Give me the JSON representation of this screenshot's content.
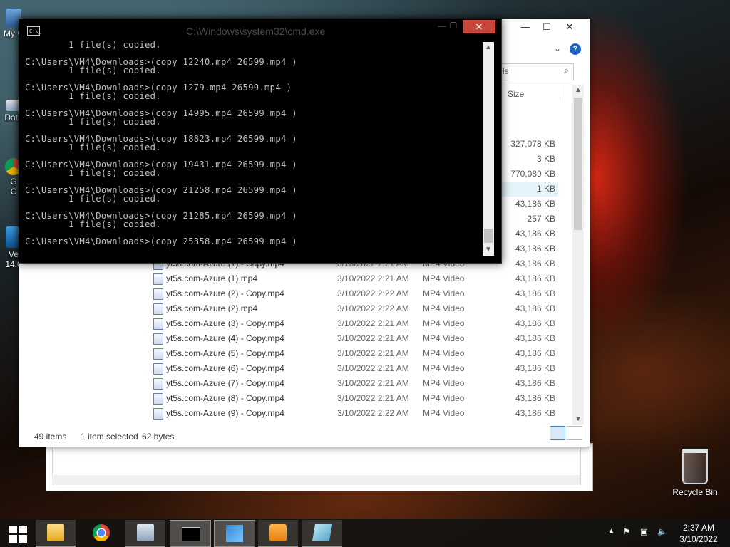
{
  "desktop": {
    "icons": [
      {
        "label": "My C",
        "name": "my-computer"
      },
      {
        "label": "Data",
        "name": "data"
      },
      {
        "label": "G\nC",
        "name": "google-chrome"
      },
      {
        "label": "Ve\n14.0",
        "name": "ve-14"
      }
    ],
    "recycle_bin": "Recycle Bin"
  },
  "cmd": {
    "title": "C:\\Windows\\system32\\cmd.exe",
    "close_glyph": "✕",
    "lines": [
      "        1 file(s) copied.",
      "",
      "C:\\Users\\VM4\\Downloads>(copy 12240.mp4 26599.mp4 )",
      "        1 file(s) copied.",
      "",
      "C:\\Users\\VM4\\Downloads>(copy 1279.mp4 26599.mp4 )",
      "        1 file(s) copied.",
      "",
      "C:\\Users\\VM4\\Downloads>(copy 14995.mp4 26599.mp4 )",
      "        1 file(s) copied.",
      "",
      "C:\\Users\\VM4\\Downloads>(copy 18823.mp4 26599.mp4 )",
      "        1 file(s) copied.",
      "",
      "C:\\Users\\VM4\\Downloads>(copy 19431.mp4 26599.mp4 )",
      "        1 file(s) copied.",
      "",
      "C:\\Users\\VM4\\Downloads>(copy 21258.mp4 26599.mp4 )",
      "        1 file(s) copied.",
      "",
      "C:\\Users\\VM4\\Downloads>(copy 21285.mp4 26599.mp4 )",
      "        1 file(s) copied.",
      "",
      "C:\\Users\\VM4\\Downloads>(copy 25358.mp4 26599.mp4 )"
    ]
  },
  "explorer": {
    "search_placeholder": "ls",
    "size_header": "Size",
    "upper_sizes": [
      "327,078 KB",
      "3 KB",
      "770,089 KB",
      "1 KB",
      "43,186 KB",
      "257 KB",
      "43,186 KB",
      "43,186 KB"
    ],
    "rows": [
      {
        "name": "yt5s.com-Azure (1) - Copy.mp4",
        "date": "3/10/2022 2:21 AM",
        "type": "MP4 Video",
        "size": "43,186 KB"
      },
      {
        "name": "yt5s.com-Azure (1).mp4",
        "date": "3/10/2022 2:21 AM",
        "type": "MP4 Video",
        "size": "43,186 KB"
      },
      {
        "name": "yt5s.com-Azure (2) - Copy.mp4",
        "date": "3/10/2022 2:22 AM",
        "type": "MP4 Video",
        "size": "43,186 KB"
      },
      {
        "name": "yt5s.com-Azure (2).mp4",
        "date": "3/10/2022 2:22 AM",
        "type": "MP4 Video",
        "size": "43,186 KB"
      },
      {
        "name": "yt5s.com-Azure (3) - Copy.mp4",
        "date": "3/10/2022 2:21 AM",
        "type": "MP4 Video",
        "size": "43,186 KB"
      },
      {
        "name": "yt5s.com-Azure (4) - Copy.mp4",
        "date": "3/10/2022 2:21 AM",
        "type": "MP4 Video",
        "size": "43,186 KB"
      },
      {
        "name": "yt5s.com-Azure (5) - Copy.mp4",
        "date": "3/10/2022 2:21 AM",
        "type": "MP4 Video",
        "size": "43,186 KB"
      },
      {
        "name": "yt5s.com-Azure (6) - Copy.mp4",
        "date": "3/10/2022 2:21 AM",
        "type": "MP4 Video",
        "size": "43,186 KB"
      },
      {
        "name": "yt5s.com-Azure (7) - Copy.mp4",
        "date": "3/10/2022 2:21 AM",
        "type": "MP4 Video",
        "size": "43,186 KB"
      },
      {
        "name": "yt5s.com-Azure (8) - Copy.mp4",
        "date": "3/10/2022 2:21 AM",
        "type": "MP4 Video",
        "size": "43,186 KB"
      },
      {
        "name": "yt5s.com-Azure (9) - Copy.mp4",
        "date": "3/10/2022 2:22 AM",
        "type": "MP4 Video",
        "size": "43,186 KB"
      }
    ],
    "status": {
      "count": "49 items",
      "selected": "1 item selected",
      "selected_size": "62 bytes"
    }
  },
  "taskbar": {
    "items": [
      "File Explorer",
      "Google Chrome",
      "Task Manager",
      "Command Prompt",
      "Video Editor",
      "Media Player",
      "Notepad"
    ],
    "active_index": 3
  },
  "clock": {
    "time": "2:37 AM",
    "date": "3/10/2022"
  },
  "colors": {
    "cmd_close": "#c7473c",
    "console_text": "#c0c0c0",
    "selection": "#e5f3fb"
  }
}
